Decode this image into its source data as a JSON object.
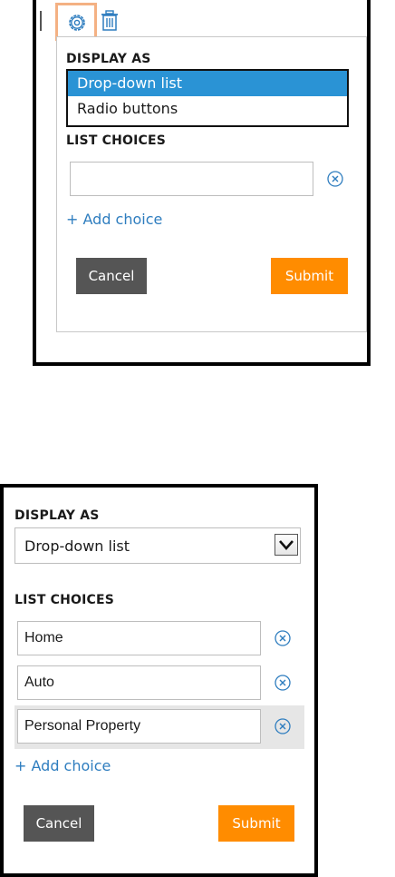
{
  "panel_top": {
    "icons": {
      "settings": "gear-icon",
      "delete": "trash-icon"
    },
    "display_as": {
      "label": "DISPLAY AS",
      "options": [
        {
          "label": "Drop-down list",
          "selected": true
        },
        {
          "label": "Radio buttons",
          "selected": false
        }
      ]
    },
    "list_choices": {
      "label": "LIST CHOICES",
      "choices": [
        {
          "value": ""
        }
      ]
    },
    "add_choice_label": "+ Add choice",
    "cancel_label": "Cancel",
    "submit_label": "Submit"
  },
  "panel_bottom": {
    "display_as": {
      "label": "DISPLAY AS",
      "selected": "Drop-down list"
    },
    "list_choices": {
      "label": "LIST CHOICES",
      "choices": [
        {
          "value": "Home"
        },
        {
          "value": "Auto"
        },
        {
          "value": "Personal Property"
        }
      ]
    },
    "add_choice_label": "+ Add choice",
    "cancel_label": "Cancel",
    "submit_label": "Submit"
  },
  "colors": {
    "selected_option_bg": "#2a93d5",
    "link_blue": "#2e7dbf",
    "submit_orange": "#ff8c00",
    "cancel_gray": "#555555",
    "settings_highlight": "#f4b183"
  }
}
